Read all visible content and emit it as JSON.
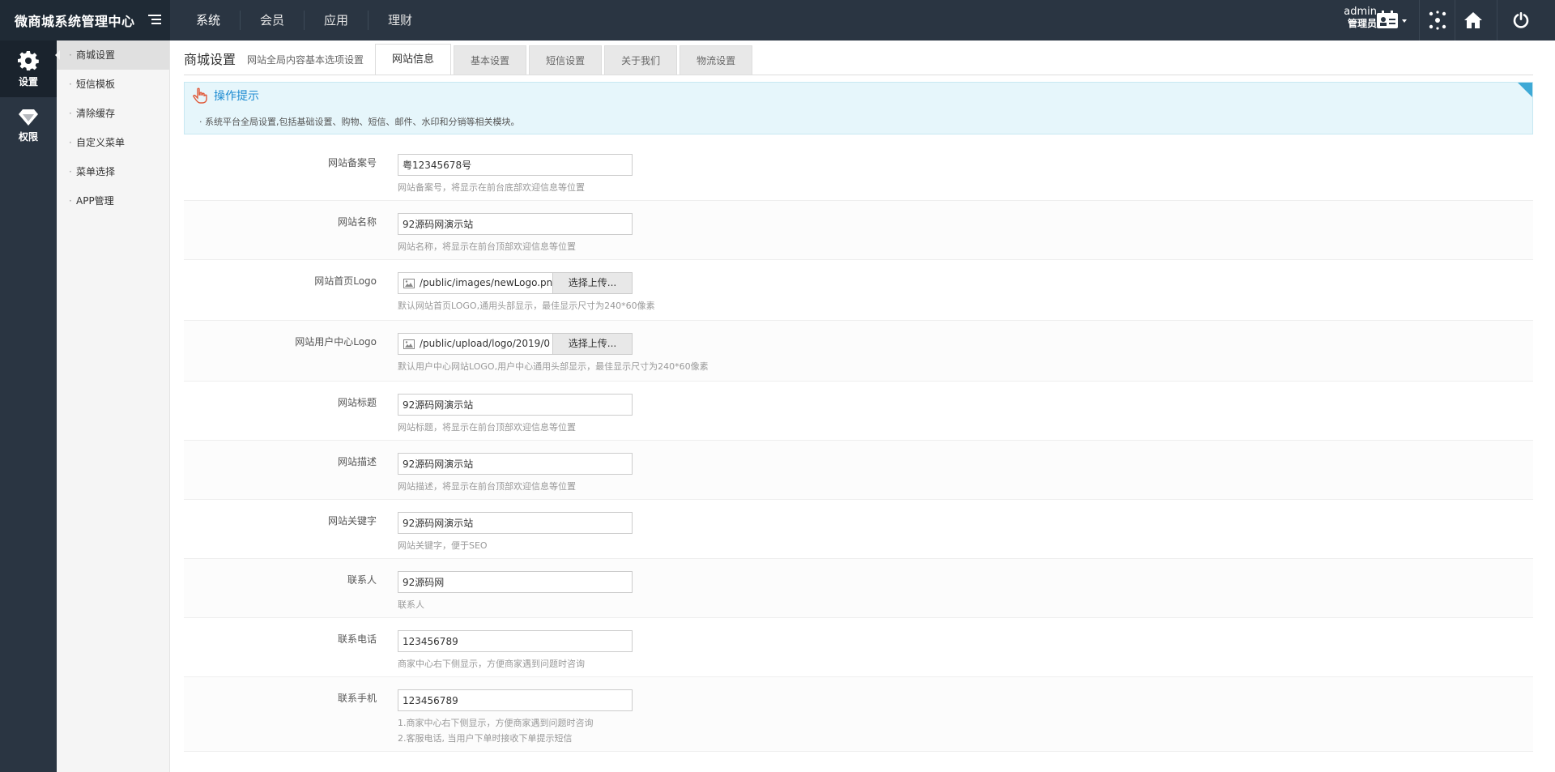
{
  "app": {
    "title": "微商城系统管理中心"
  },
  "topnav": {
    "items": [
      "系统",
      "会员",
      "应用",
      "理财"
    ]
  },
  "user": {
    "name": "admin",
    "role": "管理员"
  },
  "rail": {
    "items": [
      {
        "label": "设置",
        "icon": "gear-icon"
      },
      {
        "label": "权限",
        "icon": "diamond-icon"
      }
    ]
  },
  "submenu": {
    "items": [
      "商城设置",
      "短信模板",
      "清除缓存",
      "自定义菜单",
      "菜单选择",
      "APP管理"
    ]
  },
  "page": {
    "title": "商城设置",
    "subtitle": "网站全局内容基本选项设置"
  },
  "tabs": [
    "网站信息",
    "基本设置",
    "短信设置",
    "关于我们",
    "物流设置"
  ],
  "tip": {
    "heading": "操作提示",
    "text": "· 系统平台全局设置,包括基础设置、购物、短信、邮件、水印和分销等相关模块。"
  },
  "form": {
    "icp": {
      "label": "网站备案号",
      "value": "粤12345678号",
      "hint": "网站备案号，将显示在前台底部欢迎信息等位置"
    },
    "site_name": {
      "label": "网站名称",
      "value": "92源码网演示站",
      "hint": "网站名称，将显示在前台顶部欢迎信息等位置"
    },
    "logo": {
      "label": "网站首页Logo",
      "value": "/public/images/newLogo.png",
      "button": "选择上传...",
      "hint": "默认网站首页LOGO,通用头部显示，最佳显示尺寸为240*60像素"
    },
    "user_logo": {
      "label": "网站用户中心Logo",
      "value": "/public/upload/logo/2019/0",
      "button": "选择上传...",
      "hint": "默认用户中心网站LOGO,用户中心通用头部显示，最佳显示尺寸为240*60像素"
    },
    "site_title": {
      "label": "网站标题",
      "value": "92源码网演示站",
      "hint": "网站标题，将显示在前台顶部欢迎信息等位置"
    },
    "site_desc": {
      "label": "网站描述",
      "value": "92源码网演示站",
      "hint": "网站描述，将显示在前台顶部欢迎信息等位置"
    },
    "keywords": {
      "label": "网站关键字",
      "value": "92源码网演示站",
      "hint": "网站关键字，便于SEO"
    },
    "contact": {
      "label": "联系人",
      "value": "92源码网",
      "hint": "联系人"
    },
    "phone": {
      "label": "联系电话",
      "value": "123456789",
      "hint": "商家中心右下侧显示，方便商家遇到问题时咨询"
    },
    "mobile": {
      "label": "联系手机",
      "value": "123456789",
      "hint": "1.商家中心右下侧显示，方便商家遇到问题时咨询",
      "hint2": "2.客服电话, 当用户下单时接收下单提示短信"
    }
  }
}
